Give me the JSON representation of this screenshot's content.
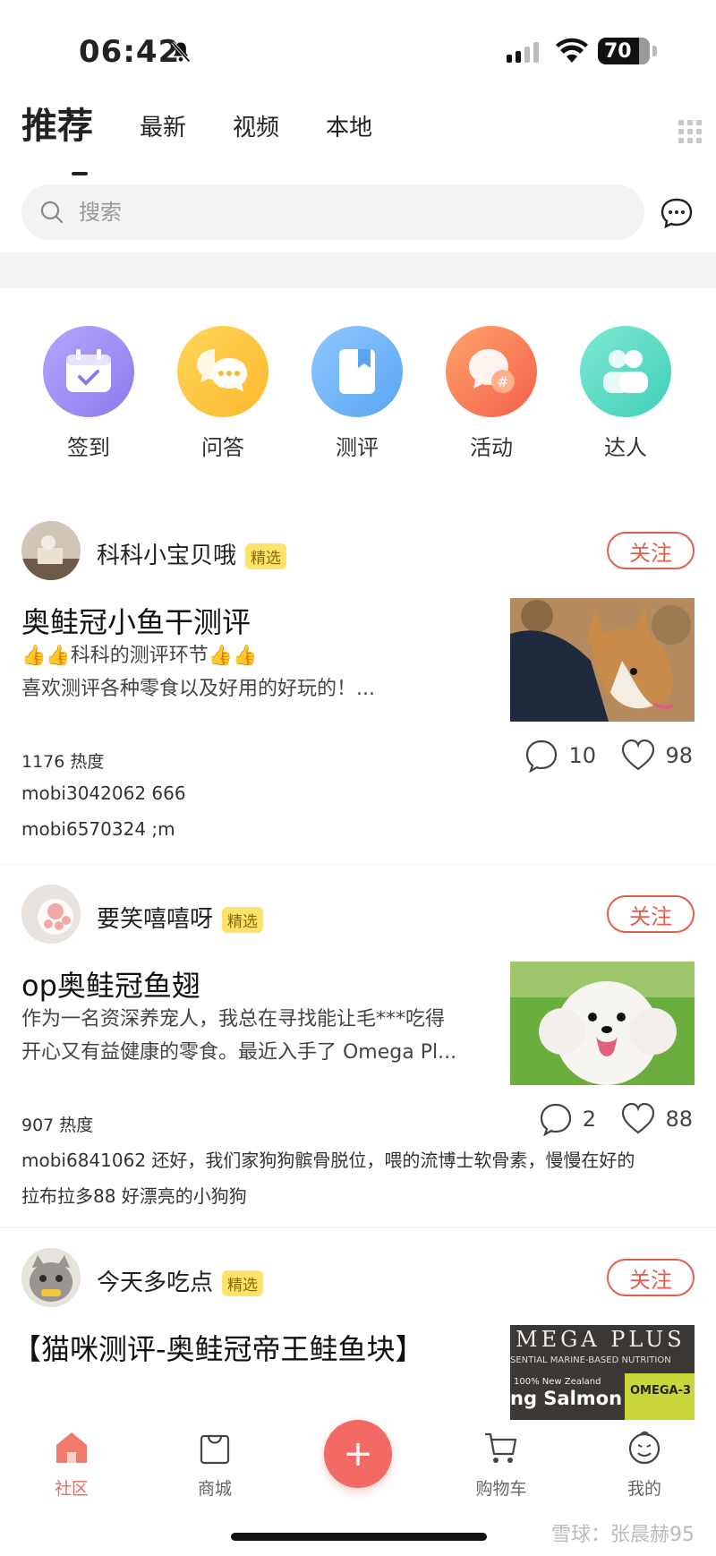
{
  "status_bar": {
    "time": "06:42",
    "battery": "70"
  },
  "tabs": [
    {
      "label": "推荐",
      "active": true
    },
    {
      "label": "最新"
    },
    {
      "label": "视频"
    },
    {
      "label": "本地"
    }
  ],
  "search": {
    "placeholder": "搜索"
  },
  "shortcuts": [
    {
      "label": "签到",
      "icon": "calendar-check-icon",
      "color": "#9b8cf2"
    },
    {
      "label": "问答",
      "icon": "chat-bubbles-icon",
      "color": "#fdc43a"
    },
    {
      "label": "测评",
      "icon": "bookmark-book-icon",
      "color": "#6ab2f5"
    },
    {
      "label": "活动",
      "icon": "hashtag-bubble-icon",
      "color": "#f77d5a"
    },
    {
      "label": "达人",
      "icon": "people-icon",
      "color": "#4fd8c2"
    }
  ],
  "posts": [
    {
      "author": "科科小宝贝哦",
      "badge": "精选",
      "follow": "关注",
      "title": "奥鲑冠小鱼干测评",
      "excerpt_line1": "👍👍科科的测评环节👍👍",
      "excerpt_line2": "喜欢测评各种零食以及好用的好玩的！...",
      "heat": "1176 热度",
      "comments_count": "10",
      "likes_count": "98",
      "comment_1": "mobi3042062 666",
      "comment_2": "mobi6570324 ;m"
    },
    {
      "author": "要笑嘻嘻呀",
      "badge": "精选",
      "follow": "关注",
      "title": "op奥鲑冠鱼翅",
      "excerpt_line1": "作为一名资深养宠人，我总在寻找能让毛***吃得",
      "excerpt_line2": "开心又有益健康的零食。最近入手了 Omega Pl...",
      "heat": "907 热度",
      "comments_count": "2",
      "likes_count": "88",
      "comment_1": "mobi6841062 还好，我们家狗狗髌骨脱位，喂的流博士软骨素，慢慢在好的",
      "comment_2": "拉布拉多88 好漂亮的小狗狗"
    },
    {
      "author": "今天多吃点",
      "badge": "精选",
      "follow": "关注",
      "title": "【猫咪测评-奥鲑冠帝王鲑鱼块】",
      "thumb_text_1": "MEGA PLUS",
      "thumb_text_2": "SENTIAL MARINE-BASED NUTRITION",
      "thumb_text_3": "100% New Zealand",
      "thumb_text_4": "ng Salmon",
      "thumb_text_5": "OMEGA-3"
    }
  ],
  "bottom_nav": [
    {
      "label": "社区",
      "active": true
    },
    {
      "label": "商城"
    },
    {
      "label": "购物车"
    },
    {
      "label": "我的"
    }
  ],
  "plus_label": "+",
  "watermark": "雪球：张晨赫95"
}
